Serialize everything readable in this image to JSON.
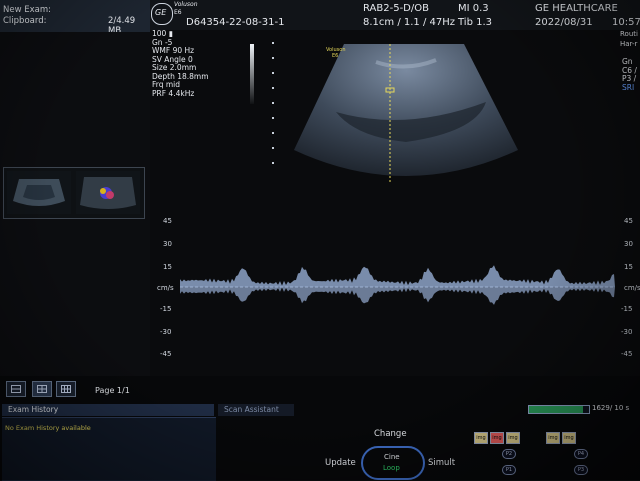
{
  "clipboard": {
    "new_exam": "New Exam:",
    "clipboard_label": "Clipboard:",
    "size": "2/4.49 MB"
  },
  "header": {
    "brand_logo": "GE",
    "brand_top": "Voluson",
    "brand_bottom": "E6",
    "patient_id": "D64354-22-08-31-1",
    "probe": "RAB2-5-D/OB",
    "depth_info": "8.1cm / 1.1 / 47Hz",
    "mi": "MI  0.3",
    "tib": "Tib  1.3",
    "company": "GE HEALTHCARE",
    "date": "2022/08/31",
    "time": "10:57",
    "rt1": "Routi",
    "rt2": "Har-r"
  },
  "params": [
    "100 ▮",
    "Gn  -5",
    "WMF 90 Hz",
    "SV Angle  0",
    "Size  2.0mm",
    "Depth 18.8mm",
    "Frq mid",
    "PRF 4.4kHz"
  ],
  "right_params": [
    "Gn",
    "C6 /",
    "P3 /",
    "SRI"
  ],
  "image_overlay": {
    "brand_top": "Voluson",
    "brand_bottom": "E6"
  },
  "doppler": {
    "unit": "cm/s",
    "scale": [
      "45",
      "30",
      "15",
      "-15",
      "-30",
      "-45"
    ]
  },
  "bottom": {
    "page": "Page 1/1",
    "tab_history": "Exam History",
    "tab_scan": "Scan Assistant",
    "history_text": "No Exam History available",
    "change": "Change",
    "update": "Update",
    "cine": "Cine",
    "loop": "Loop",
    "simult": "Simult",
    "frames": "1629/ 10 s",
    "frame_progress": 0.9,
    "img_label": "img",
    "p_buttons": [
      "P2",
      "P1",
      "P4",
      "P3"
    ]
  },
  "colors": {
    "accent_green": "#2fd06a",
    "doppler_blue": "#9fb8e0",
    "tab_bg": "#1f2c44"
  }
}
